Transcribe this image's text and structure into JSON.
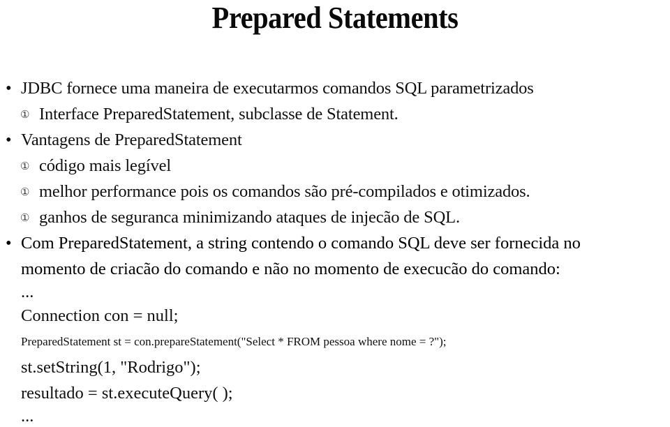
{
  "slide": {
    "title": "Prepared Statements",
    "bullet_glyphs": {
      "level1": "•",
      "level2": "①"
    },
    "content": [
      {
        "id": "jdbc-intro",
        "level": 1,
        "text": "JDBC fornece uma maneira de executarmos comandos SQL parametrizados"
      },
      {
        "id": "interface-preparedstatement",
        "level": 2,
        "text": "Interface PreparedStatement, subclasse de Statement."
      },
      {
        "id": "vantagens",
        "level": 1,
        "text": "Vantagens de PreparedStatement"
      },
      {
        "id": "codigo-legivel",
        "level": 2,
        "text": "código mais legível"
      },
      {
        "id": "melhor-performance",
        "level": 2,
        "text": "melhor performance pois os comandos são pré-compilados e otimizados."
      },
      {
        "id": "ganhos-seguranca",
        "level": 2,
        "text": "ganhos de seguranca minimizando ataques de injecão de SQL."
      }
    ],
    "paragraph": {
      "id": "com-preparedstatement",
      "level": 1,
      "line1": "Com PreparedStatement, a string contendo o comando SQL deve ser fornecida no",
      "line2": "momento de criacão do comando e não no momento de execucão do comando:"
    },
    "code": {
      "ellipsis_top": "...",
      "lines": [
        "Connection con = null;",
        "PreparedStatement st = con.prepareStatement(\"Select * FROM pessoa where nome = ?\");",
        "st.setString(1, \"Rodrigo\");",
        "resultado = st.executeQuery( );"
      ],
      "ellipsis_bottom": "..."
    }
  }
}
